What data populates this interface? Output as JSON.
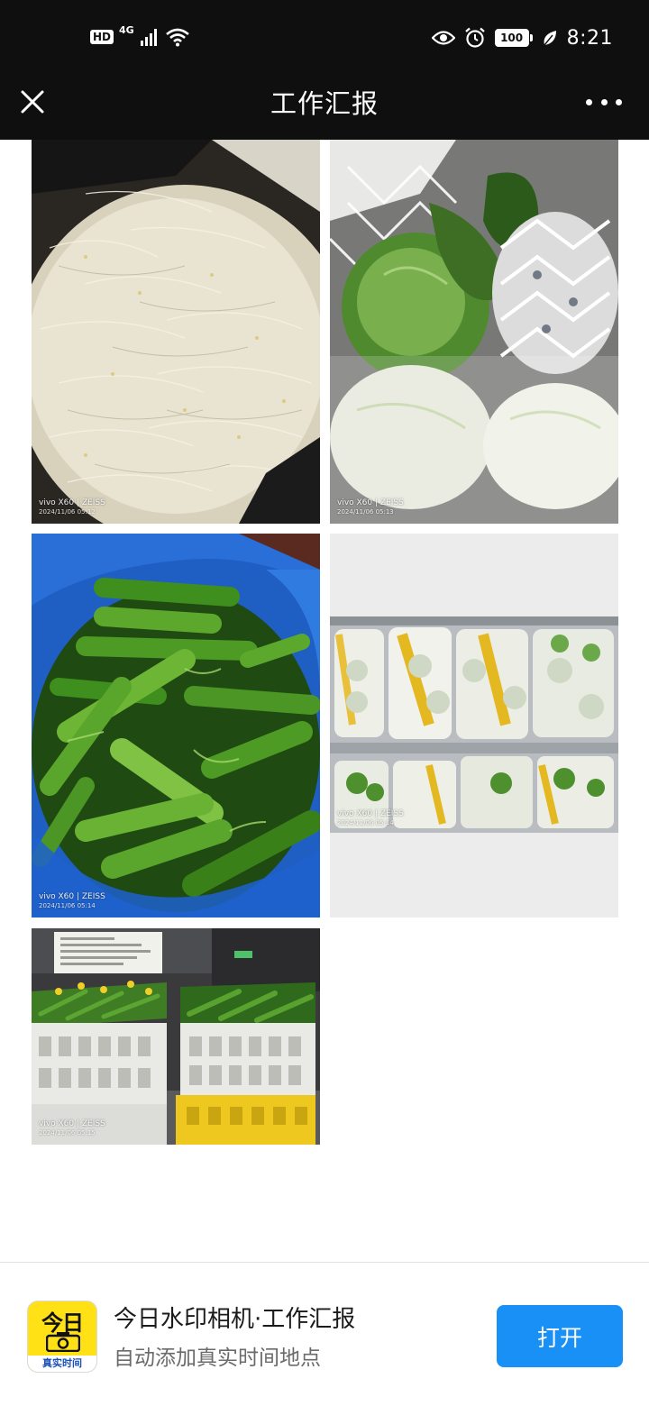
{
  "status_bar": {
    "hd": "HD",
    "network": "4G",
    "battery": "100",
    "time": "8:21",
    "icons": [
      "signal-icon",
      "wifi-icon",
      "eye-icon",
      "alarm-icon",
      "battery-icon",
      "leaf-icon"
    ]
  },
  "nav": {
    "title": "工作汇报",
    "close_icon": "close-icon",
    "more_icon": "more-icon"
  },
  "photos": [
    {
      "subject": "bean sprouts",
      "watermark_brand": "vivo X60 | ZEISS",
      "watermark_time": "2024/11/06 05:12"
    },
    {
      "subject": "cabbage",
      "watermark_brand": "vivo X60 | ZEISS",
      "watermark_time": "2024/11/06 05:13"
    },
    {
      "subject": "green peppers",
      "watermark_brand": "vivo X60 | ZEISS",
      "watermark_time": "2024/11/06 05:14"
    },
    {
      "subject": "bok choy on shelf",
      "watermark_brand": "vivo X60 | ZEISS",
      "watermark_time": "2024/11/06 05:14"
    },
    {
      "subject": "greens in crates",
      "watermark_brand": "vivo X60 | ZEISS",
      "watermark_time": "2024/11/06 05:15"
    }
  ],
  "banner": {
    "icon_glyph": "今日",
    "icon_caption": "真实时间",
    "title": "今日水印相机·工作汇报",
    "subtitle": "自动添加真实时间地点",
    "open_label": "打开"
  },
  "colors": {
    "status_bg": "#0f0f0f",
    "accent": "#1890f5",
    "app_icon_yellow": "#ffe115"
  }
}
